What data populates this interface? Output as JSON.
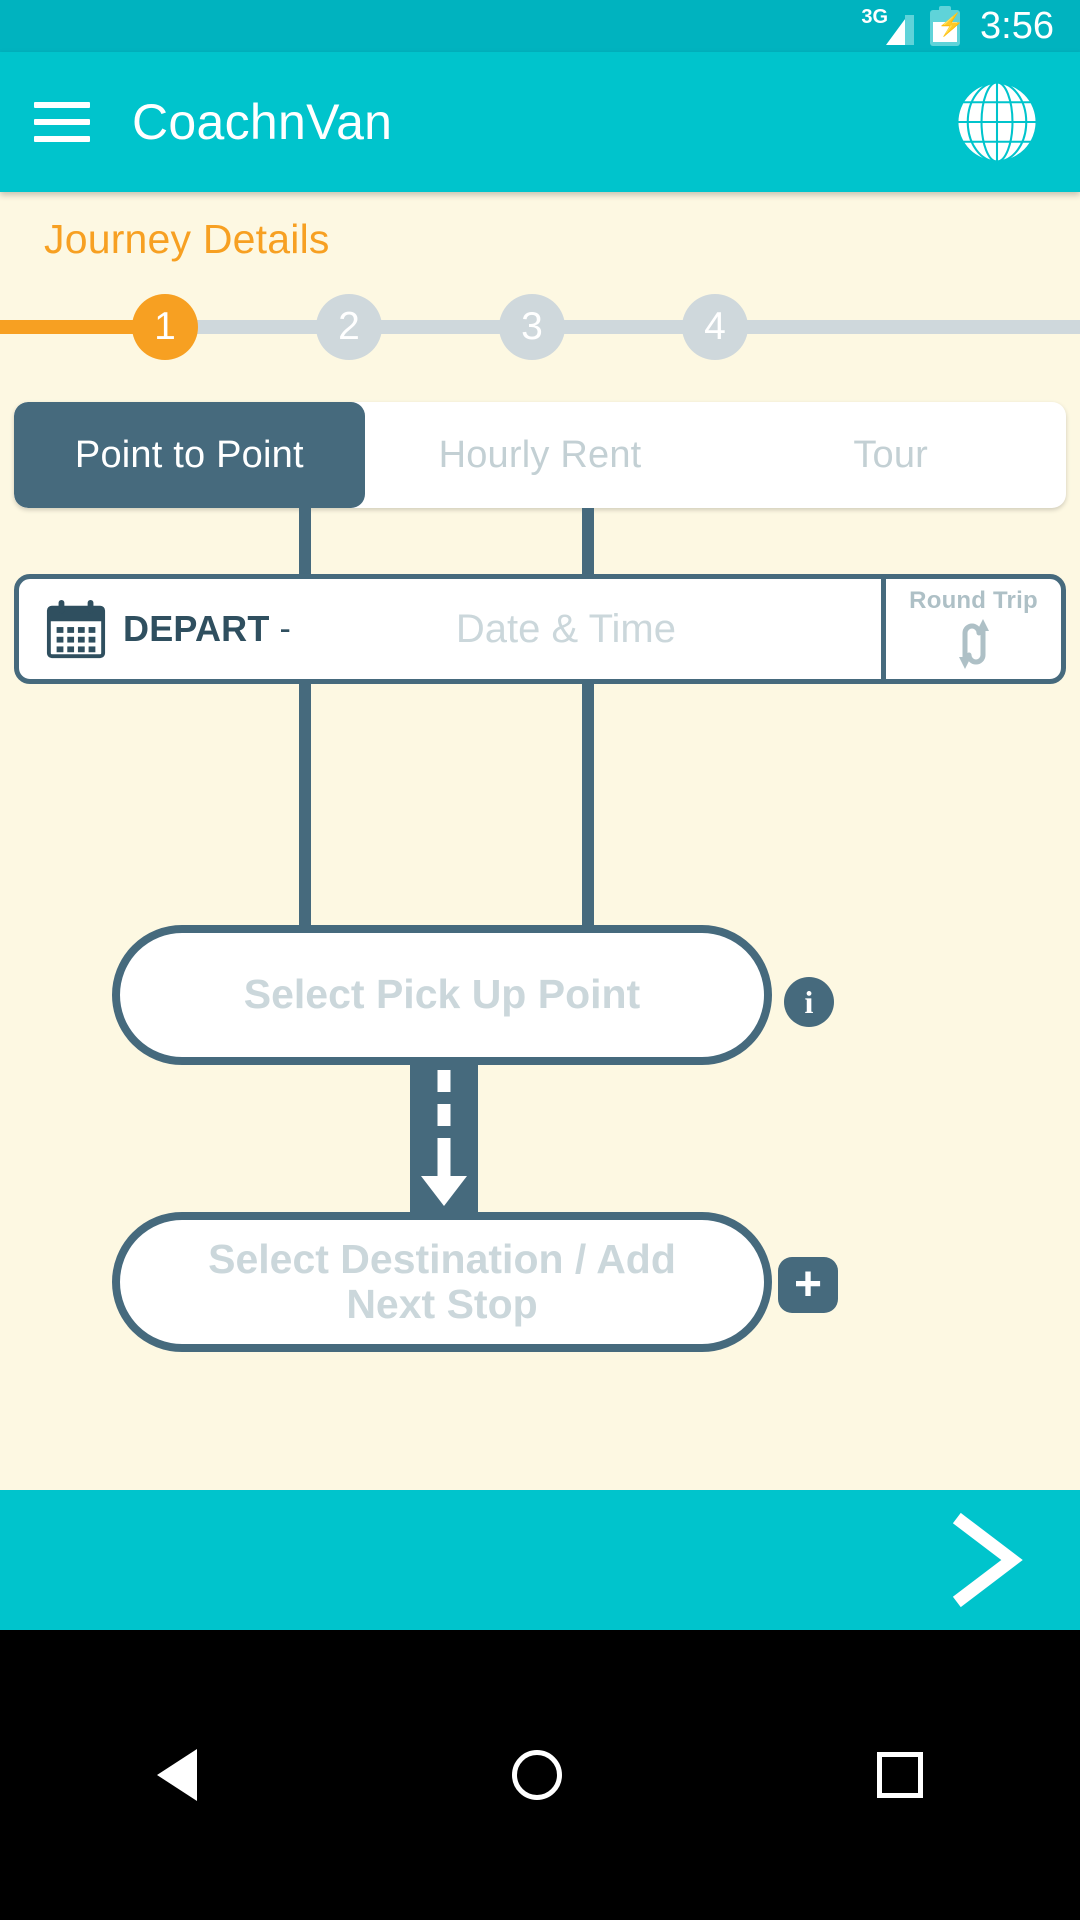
{
  "status_bar": {
    "network_type": "3G",
    "time": "3:56",
    "signal_icon": "signal-bars-icon",
    "battery_icon": "battery-charging-icon"
  },
  "app_bar": {
    "title": "CoachnVan",
    "menu_icon": "hamburger-menu-icon",
    "globe_icon": "globe-icon"
  },
  "page": {
    "section_title": "Journey Details"
  },
  "stepper": {
    "steps": [
      {
        "label": "1",
        "state": "active"
      },
      {
        "label": "2",
        "state": "inactive"
      },
      {
        "label": "3",
        "state": "inactive"
      },
      {
        "label": "4",
        "state": "inactive"
      }
    ]
  },
  "tabs": [
    {
      "label": "Point to Point",
      "active": true
    },
    {
      "label": "Hourly Rent",
      "active": false
    },
    {
      "label": "Tour",
      "active": false
    }
  ],
  "depart_row": {
    "calendar_icon": "calendar-icon",
    "label": "DEPART",
    "separator": "-",
    "placeholder": "Date & Time",
    "round_trip_label": "Round Trip",
    "round_trip_icon": "swap-arrows-icon"
  },
  "route": {
    "pickup_label": "Select Pick Up Point",
    "pickup_info_icon": "info-icon",
    "connector_icon": "dashed-down-arrow-icon",
    "destination_label": "Select Destination / Add Next Stop",
    "add_stop_icon": "plus-icon"
  },
  "footer": {
    "next_icon": "chevron-right-icon"
  },
  "nav_bar": {
    "back_icon": "back-triangle-icon",
    "home_icon": "home-circle-icon",
    "recents_icon": "recents-square-icon"
  },
  "colors": {
    "teal": "#00C4CC",
    "teal_dark": "#00B3BF",
    "orange": "#F7A022",
    "slate": "#466A7D",
    "cream": "#FDF8E2",
    "muted_text": "#CBD7DB",
    "step_inactive": "#CFD8DC"
  }
}
